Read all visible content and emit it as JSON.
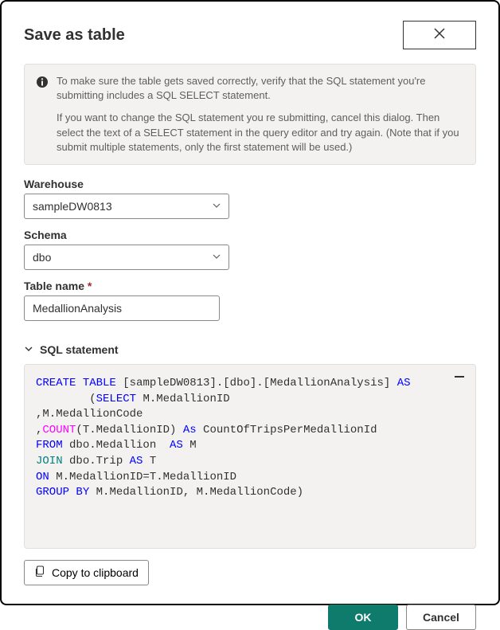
{
  "dialog": {
    "title": "Save as table",
    "info": {
      "p1": "To make sure the table gets saved correctly, verify that the SQL statement you're submitting includes a SQL SELECT statement.",
      "p2": "If you want to change the SQL statement you re submitting, cancel this dialog. Then select the text of a SELECT statement in the query editor and try again. (Note that if you submit multiple statements, only the first statement will be used.)"
    },
    "warehouse": {
      "label": "Warehouse",
      "value": "sampleDW0813"
    },
    "schema": {
      "label": "Schema",
      "value": "dbo"
    },
    "tableName": {
      "label": "Table name",
      "required": "*",
      "value": "MedallionAnalysis"
    },
    "sqlStatement": {
      "label": "SQL statement",
      "tokens": [
        {
          "t": "CREATE",
          "c": "kw-blue"
        },
        {
          "t": " "
        },
        {
          "t": "TABLE",
          "c": "kw-blue"
        },
        {
          "t": " [sampleDW0813].[dbo].[MedallionAnalysis] "
        },
        {
          "t": "AS",
          "c": "kw-blue"
        },
        {
          "t": "\n        ("
        },
        {
          "t": "SELECT",
          "c": "kw-blue"
        },
        {
          "t": " M.MedallionID\n,M.MedallionCode\n,"
        },
        {
          "t": "COUNT",
          "c": "kw-magenta"
        },
        {
          "t": "(T.MedallionID) "
        },
        {
          "t": "As",
          "c": "kw-blue"
        },
        {
          "t": " CountOfTripsPerMedallionId\n"
        },
        {
          "t": "FROM",
          "c": "kw-blue"
        },
        {
          "t": " dbo.Medallion  "
        },
        {
          "t": "AS",
          "c": "kw-blue"
        },
        {
          "t": " M\n"
        },
        {
          "t": "JOIN",
          "c": "kw-teal"
        },
        {
          "t": " dbo.Trip "
        },
        {
          "t": "AS",
          "c": "kw-blue"
        },
        {
          "t": " T\n"
        },
        {
          "t": "ON",
          "c": "kw-blue"
        },
        {
          "t": " M.MedallionID=T.MedallionID\n"
        },
        {
          "t": "GROUP",
          "c": "kw-blue"
        },
        {
          "t": " "
        },
        {
          "t": "BY",
          "c": "kw-blue"
        },
        {
          "t": " M.MedallionID, M.MedallionCode)"
        }
      ]
    },
    "copyLabel": "Copy to clipboard",
    "okLabel": "OK",
    "cancelLabel": "Cancel"
  }
}
